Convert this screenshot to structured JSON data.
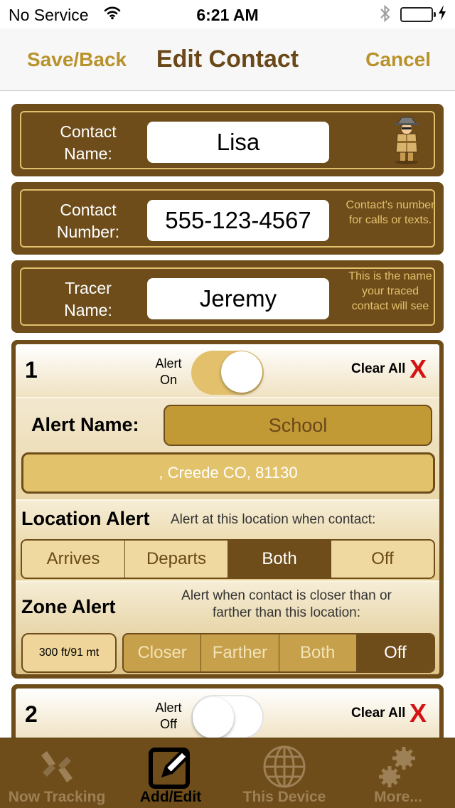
{
  "status_bar": {
    "carrier": "No Service",
    "time": "6:21 AM",
    "wifi_icon": "wifi-icon",
    "bluetooth_icon": "bluetooth-icon",
    "battery_level": 0.95,
    "battery_color": "#34c24a",
    "charging": true
  },
  "nav": {
    "left_label": "Save/Back",
    "title": "Edit Contact",
    "right_label": "Cancel"
  },
  "colors": {
    "brown": "#6e4d1b",
    "gold": "#e2c06c",
    "nav_text": "#b8922c",
    "title_text": "#6a4818",
    "clear_x": "#d21414"
  },
  "contact_name": {
    "label_line1": "Contact",
    "label_line2": "Name:",
    "value": "Lisa",
    "icon": "spy-detective-icon"
  },
  "contact_number": {
    "label_line1": "Contact",
    "label_line2": "Number:",
    "value": "555-123-4567",
    "hint_line1": "Contact's number",
    "hint_line2": "for calls or texts."
  },
  "tracer_name": {
    "label_line1": "Tracer",
    "label_line2": "Name:",
    "value": "Jeremy",
    "hint_line1": "This is the name",
    "hint_line2": "your traced",
    "hint_line3": "contact will see"
  },
  "alerts": [
    {
      "number": "1",
      "toggle_line1": "Alert",
      "toggle_line2": "On",
      "enabled": true,
      "clear_label": "Clear All",
      "clear_icon": "X",
      "name_label": "Alert Name:",
      "name_value": "School",
      "address": ", Creede CO, 81130",
      "location_title": "Location Alert",
      "location_desc": "Alert at this location when contact:",
      "location_options": [
        "Arrives",
        "Departs",
        "Both",
        "Off"
      ],
      "location_selected": "Both",
      "zone_title": "Zone Alert",
      "zone_desc_line1": "Alert when contact is closer than or",
      "zone_desc_line2": "farther than this location:",
      "zone_distance": "300 ft/91 mt",
      "zone_options": [
        "Closer",
        "Farther",
        "Both",
        "Off"
      ],
      "zone_selected": "Off"
    },
    {
      "number": "2",
      "toggle_line1": "Alert",
      "toggle_line2": "Off",
      "enabled": false,
      "clear_label": "Clear All",
      "clear_icon": "X"
    }
  ],
  "tabs": [
    {
      "label": "Now Tracking",
      "icon": "compass-arrows-icon",
      "active": false
    },
    {
      "label": "Add/Edit",
      "icon": "edit-pencil-icon",
      "active": true
    },
    {
      "label": "This Device",
      "icon": "globe-icon",
      "active": false
    },
    {
      "label": "More...",
      "icon": "gears-icon",
      "active": false
    }
  ]
}
